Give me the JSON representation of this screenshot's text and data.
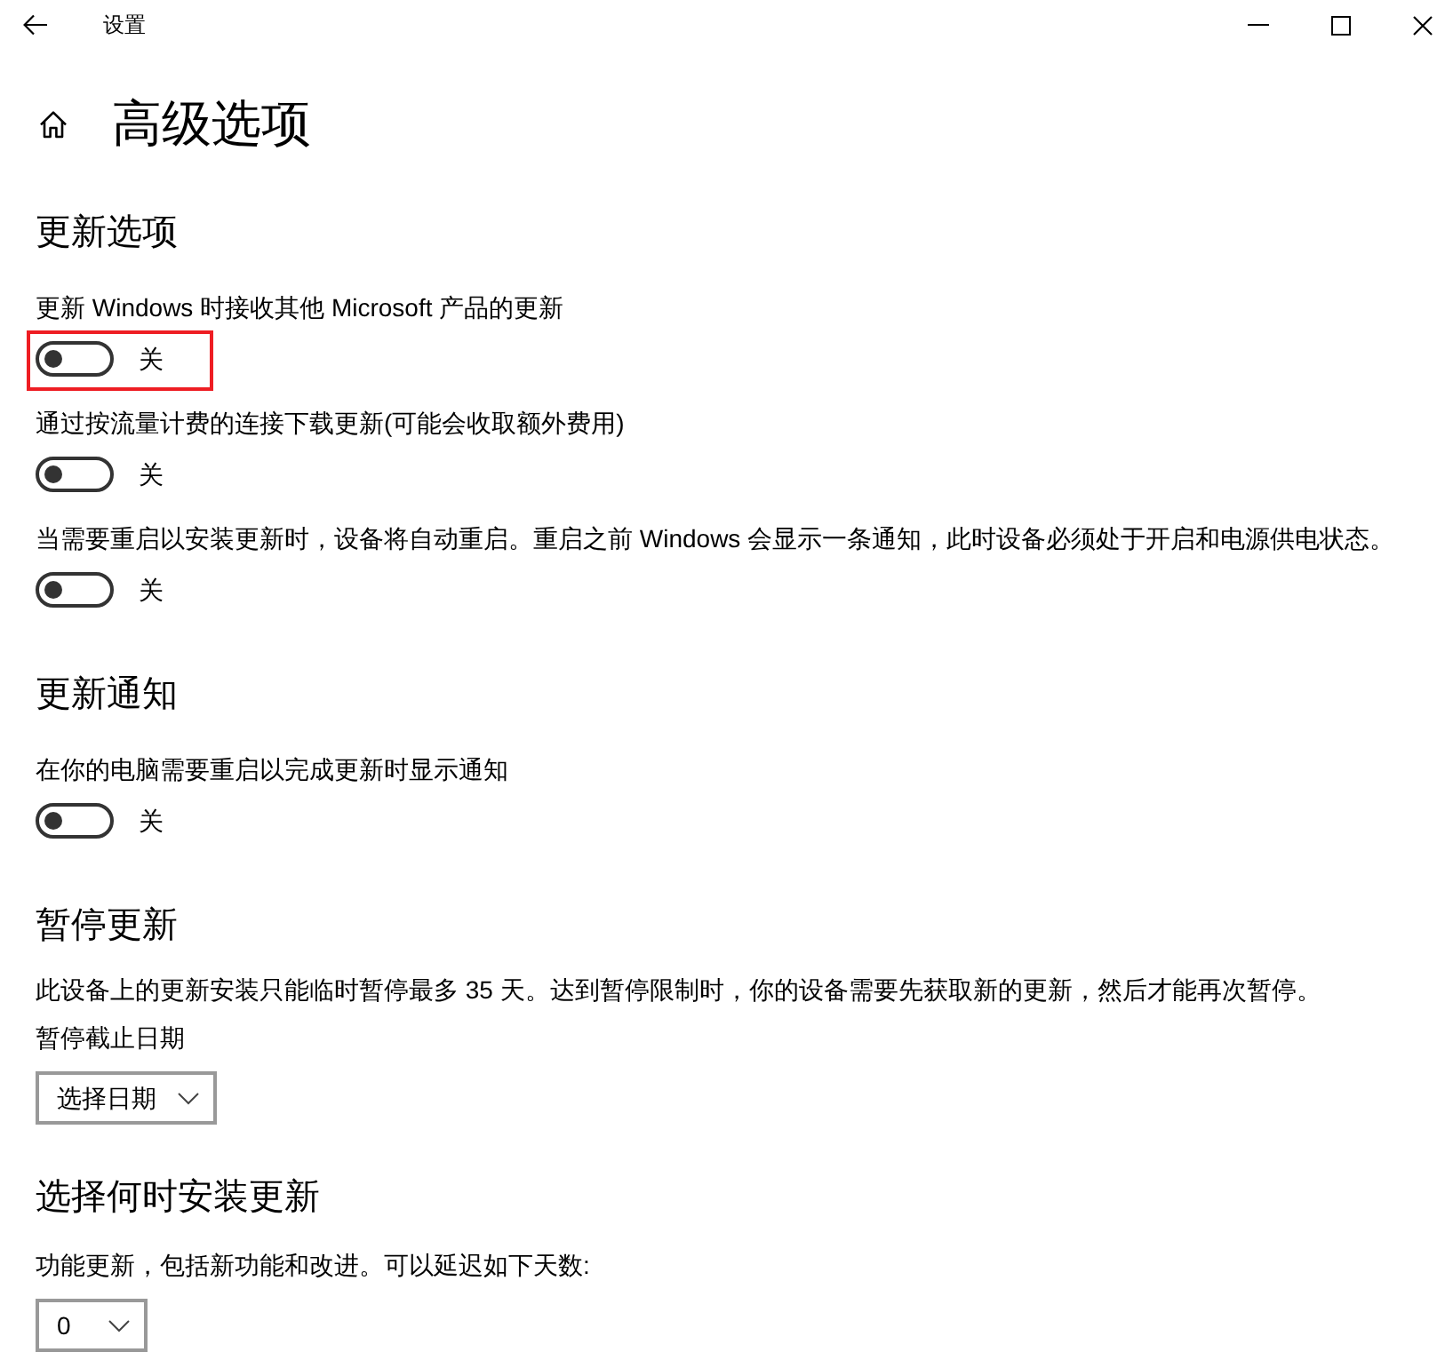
{
  "window": {
    "title": "设置"
  },
  "page": {
    "title": "高级选项"
  },
  "sections": [
    {
      "title": "更新选项",
      "items": [
        {
          "kind": "toggle",
          "label": "更新 Windows 时接收其他 Microsoft 产品的更新",
          "on": false,
          "state_text": "关",
          "highlighted": true
        },
        {
          "kind": "toggle",
          "label": "通过按流量计费的连接下载更新(可能会收取额外费用)",
          "on": false,
          "state_text": "关",
          "highlighted": false
        },
        {
          "kind": "toggle",
          "label": "当需要重启以安装更新时，设备将自动重启。重启之前 Windows 会显示一条通知，此时设备必须处于开启和电源供电状态。",
          "on": false,
          "state_text": "关",
          "highlighted": false
        }
      ]
    },
    {
      "title": "更新通知",
      "items": [
        {
          "kind": "toggle",
          "label": "在你的电脑需要重启以完成更新时显示通知",
          "on": false,
          "state_text": "关",
          "highlighted": false
        }
      ]
    },
    {
      "title": "暂停更新",
      "items": [
        {
          "kind": "text",
          "text": "此设备上的更新安装只能临时暂停最多 35 天。达到暂停限制时，你的设备需要先获取新的更新，然后才能再次暂停。"
        },
        {
          "kind": "dropdown",
          "label": "暂停截止日期",
          "value": "选择日期"
        }
      ]
    },
    {
      "title": "选择何时安装更新",
      "items": [
        {
          "kind": "dropdown",
          "label": "功能更新，包括新功能和改进。可以延迟如下天数:",
          "value": "0"
        }
      ]
    }
  ]
}
